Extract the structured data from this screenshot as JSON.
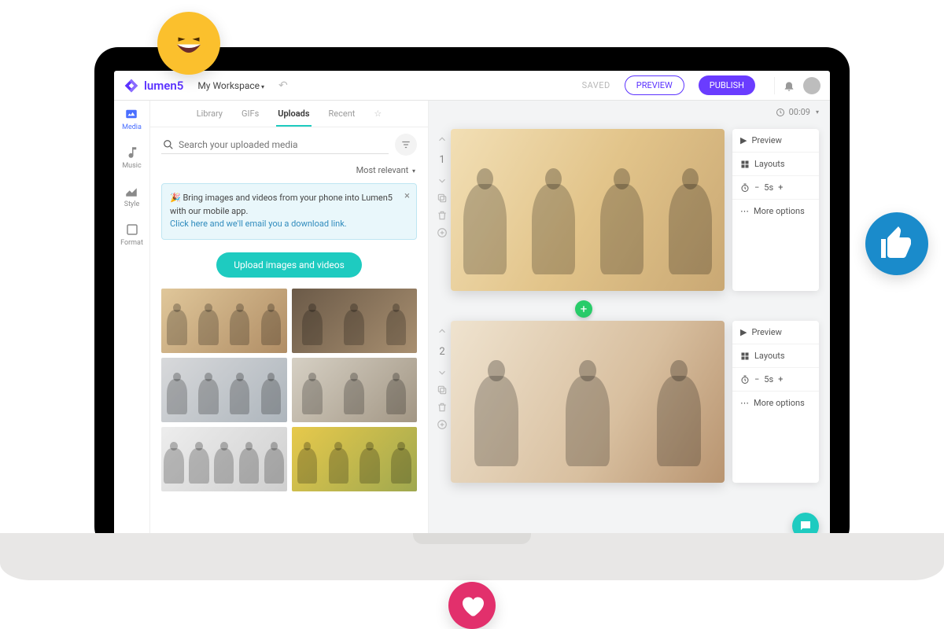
{
  "brand": "lumen5",
  "workspace": "My Workspace",
  "saved": "SAVED",
  "preview": "PREVIEW",
  "publish": "PUBLISH",
  "rail": {
    "media": "Media",
    "music": "Music",
    "style": "Style",
    "format": "Format"
  },
  "tabs": {
    "library": "Library",
    "gifs": "GIFs",
    "uploads": "Uploads",
    "recent": "Recent"
  },
  "search_placeholder": "Search your uploaded media",
  "sort": "Most relevant",
  "notice_text": "Bring images and videos from your phone into Lumen5 with our mobile app.",
  "notice_link": "Click here and we'll email you a download link.",
  "upload_btn": "Upload images and videos",
  "timecode": "00:09",
  "slide_actions": {
    "preview": "Preview",
    "layouts": "Layouts",
    "duration": "5s",
    "more": "More options"
  },
  "slides": [
    {
      "number": "1"
    },
    {
      "number": "2"
    }
  ]
}
